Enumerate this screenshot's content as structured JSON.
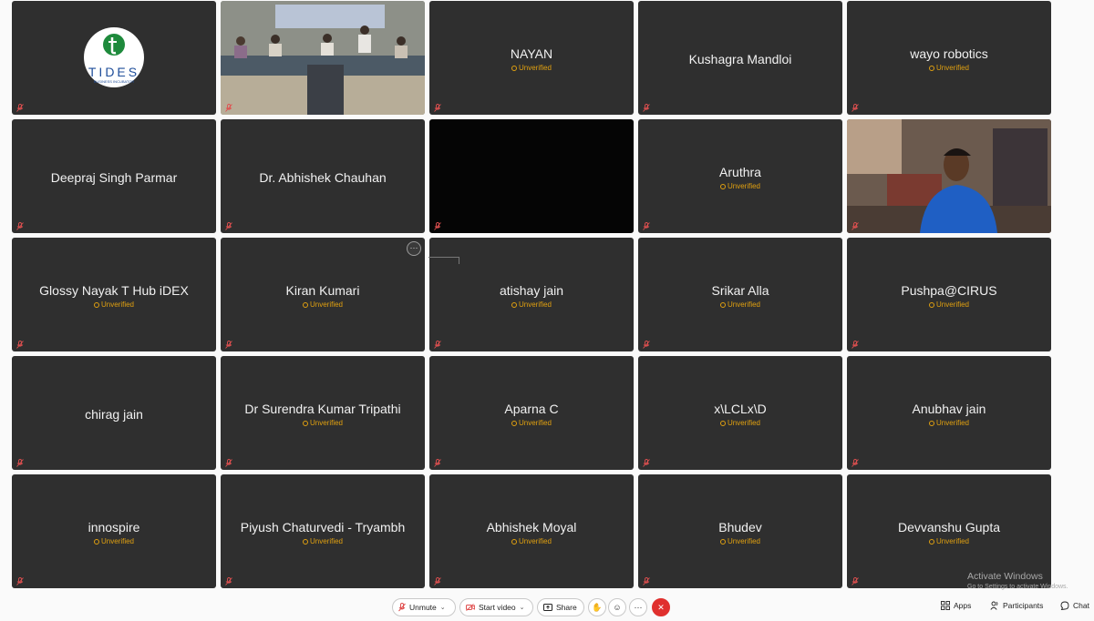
{
  "participants": [
    {
      "name": "",
      "unverified": false,
      "kind": "logo",
      "logo_text": "TIDES",
      "logo_subtext": "BUSINESS INCUBATOR"
    },
    {
      "name": "",
      "unverified": false,
      "kind": "video-room"
    },
    {
      "name": "NAYAN",
      "unverified": true,
      "kind": "text"
    },
    {
      "name": "Kushagra Mandloi",
      "unverified": false,
      "kind": "text"
    },
    {
      "name": "wayo robotics",
      "unverified": true,
      "kind": "text"
    },
    {
      "name": "Deepraj Singh Parmar",
      "unverified": false,
      "kind": "text"
    },
    {
      "name": "Dr. Abhishek Chauhan",
      "unverified": false,
      "kind": "text"
    },
    {
      "name": "",
      "unverified": false,
      "kind": "video-black"
    },
    {
      "name": "Aruthra",
      "unverified": true,
      "kind": "text"
    },
    {
      "name": "",
      "unverified": false,
      "kind": "video-person"
    },
    {
      "name": "Glossy Nayak T Hub iDEX",
      "unverified": true,
      "kind": "text"
    },
    {
      "name": "Kiran Kumari",
      "unverified": true,
      "kind": "text"
    },
    {
      "name": "atishay jain",
      "unverified": true,
      "kind": "text"
    },
    {
      "name": "Srikar Alla",
      "unverified": true,
      "kind": "text"
    },
    {
      "name": "Pushpa@CIRUS",
      "unverified": true,
      "kind": "text"
    },
    {
      "name": "chirag jain",
      "unverified": false,
      "kind": "text"
    },
    {
      "name": "Dr Surendra Kumar Tripathi",
      "unverified": true,
      "kind": "text"
    },
    {
      "name": "Aparna C",
      "unverified": true,
      "kind": "text"
    },
    {
      "name": "x\\LCLx\\D",
      "unverified": true,
      "kind": "text"
    },
    {
      "name": "Anubhav jain",
      "unverified": true,
      "kind": "text"
    },
    {
      "name": "innospire",
      "unverified": true,
      "kind": "text"
    },
    {
      "name": "Piyush Chaturvedi - Tryambh",
      "unverified": true,
      "kind": "text"
    },
    {
      "name": "Abhishek Moyal",
      "unverified": true,
      "kind": "text"
    },
    {
      "name": "Bhudev",
      "unverified": true,
      "kind": "text"
    },
    {
      "name": "Devvanshu Gupta",
      "unverified": true,
      "kind": "text"
    }
  ],
  "unverified_label": "Unverified",
  "more_options_glyph": "···",
  "toolbar": {
    "unmute_label": "Unmute",
    "start_video_label": "Start video",
    "share_label": "Share",
    "apps_label": "Apps",
    "participants_label": "Participants",
    "chat_label": "Chat"
  },
  "watermark": {
    "title": "Activate Windows",
    "subtitle": "Go to Settings to activate Windows."
  },
  "colors": {
    "tile_bg": "#2f2f2f",
    "unverified": "#e0a010",
    "mic_muted": "#e05050",
    "end_call": "#e0302e"
  }
}
